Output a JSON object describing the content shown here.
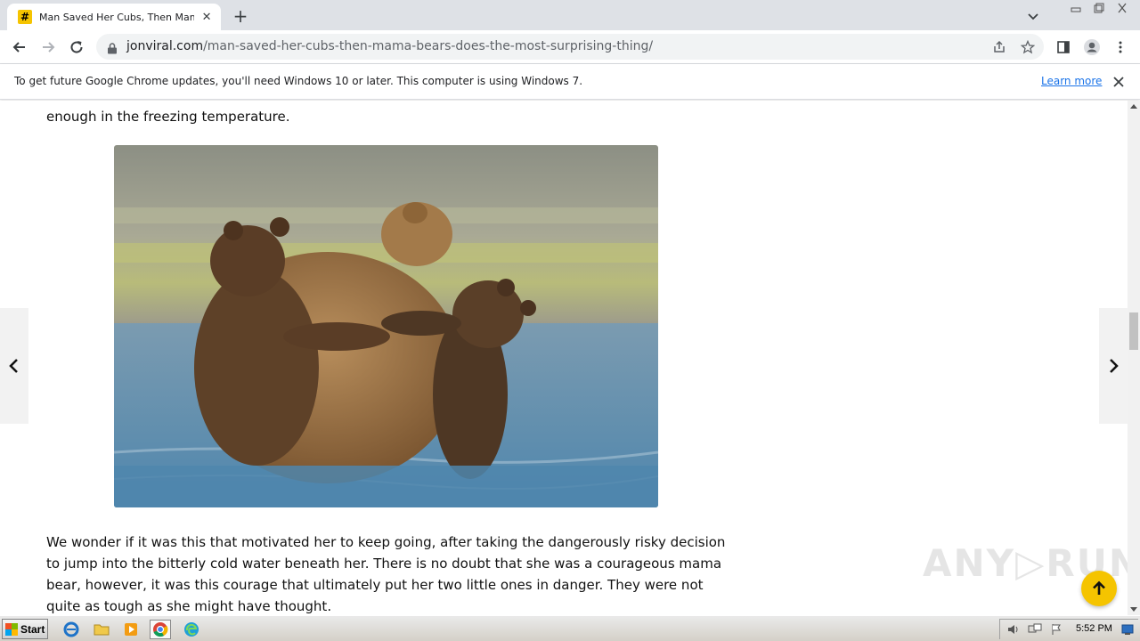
{
  "browser": {
    "tab": {
      "favicon_glyph": "#",
      "title": "Man Saved Her Cubs, Then Mama Bears Does The Most Surprising Thing",
      "close_glyph": "✕"
    },
    "new_tab_glyph": "+",
    "url": {
      "host": "jonviral.com",
      "path": "/man-saved-her-cubs-then-mama-bears-does-the-most-surprising-thing/"
    }
  },
  "infobar": {
    "message": "To get future Google Chrome updates, you'll need Windows 10 or later. This computer is using Windows 7.",
    "learn_more": "Learn more"
  },
  "article": {
    "paragraph_top": "enough in the freezing temperature.",
    "image_alt": "Mother bear in water hugged by two cubs",
    "paragraph_bottom": "We wonder if it was this that motivated her to keep going, after taking the dangerously risky decision to jump into the bitterly cold water beneath her. There is no doubt that she was a courageous mama bear, however, it was this courage that ultimately put her two little ones in danger. They were not quite as tough as she might have thought."
  },
  "watermark": "ANY▷RUN",
  "taskbar": {
    "start_label": "Start",
    "clock": "5:52 PM"
  },
  "colors": {
    "accent": "#f5c400",
    "link": "#1a73e8",
    "tabstrip": "#dee1e6"
  },
  "icons": [
    "back-icon",
    "forward-icon",
    "reload-icon",
    "lock-icon",
    "share-icon",
    "star-icon",
    "side-panel-icon",
    "profile-icon",
    "menu-icon",
    "close-icon",
    "chevron-left-icon",
    "chevron-right-icon",
    "arrow-up-icon"
  ]
}
